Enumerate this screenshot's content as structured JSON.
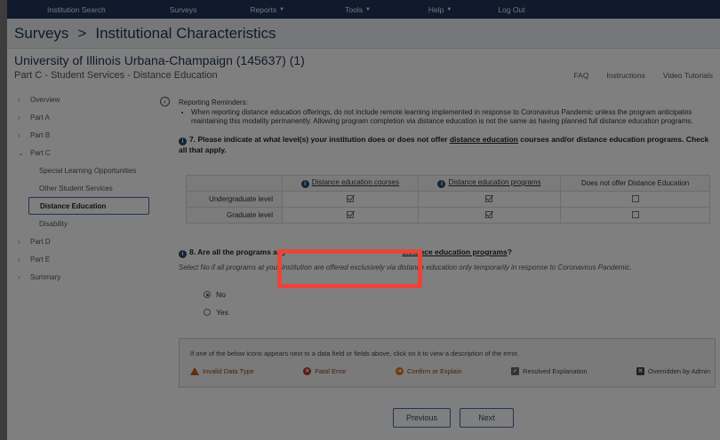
{
  "nav": {
    "items": [
      {
        "label": "Institution Search",
        "caret": false
      },
      {
        "label": "Surveys",
        "caret": false
      },
      {
        "label": "Reports",
        "caret": true
      },
      {
        "label": "Tools",
        "caret": true
      },
      {
        "label": "Help",
        "caret": true
      },
      {
        "label": "Log Out",
        "caret": false
      }
    ]
  },
  "breadcrumb": {
    "root": "Surveys",
    "separator": ">",
    "current": "Institutional Characteristics"
  },
  "institution": "University of Illinois Urbana-Champaign (145637) (1)",
  "part_title": "Part C - Student Services - Distance Education",
  "toplinks": [
    "FAQ",
    "Instructions",
    "Video Tutorials"
  ],
  "sidebar": {
    "items": [
      "Overview",
      "Part A",
      "Part B",
      "Part C"
    ],
    "sub_items": [
      "Special Learning Opportunities",
      "Other Student Services",
      "Distance Education",
      "Disability"
    ],
    "more_items": [
      "Part D",
      "Part E",
      "Summary"
    ]
  },
  "reminders": {
    "title": "Reporting Reminders:",
    "bullet": "When reporting distance education offerings, do not include remote learning implemented in response to Coronavirus Pandemic unless the program anticipates maintaining this modality permanently. Allowing program completion via distance education is not the same as having planned full distance education programs."
  },
  "q7": {
    "prefix": "7. Please indicate at what level(s) your institution does or does not offer",
    "link": "distance education",
    "suffix": "courses and/or distance education programs. Check all that apply.",
    "columns": [
      "Distance education courses",
      "Distance education programs",
      "Does not offer Distance Education"
    ],
    "rows": [
      {
        "label": "Undergraduate level",
        "values": [
          true,
          true,
          false
        ]
      },
      {
        "label": "Graduate level",
        "values": [
          true,
          true,
          false
        ]
      }
    ]
  },
  "q8": {
    "prefix": "8. Are all the programs at y",
    "link": "distance education programs",
    "suffix": "?",
    "help": "Select No if all programs at your institution are offered exclusively via distance education only temporarily in response to Coronavirus Pandemic.",
    "options": [
      {
        "label": "No",
        "selected": true
      },
      {
        "label": "Yes",
        "selected": false
      }
    ]
  },
  "legend": {
    "note": "If one of the below icons appears next to a data field or fields above, click on it to view a description of the error.",
    "items": [
      "Invalid Data Type",
      "Fatal Error",
      "Confirm or Explain",
      "Resolved Explanation",
      "Overridden by Admin"
    ]
  },
  "buttons": {
    "previous": "Previous",
    "next": "Next"
  },
  "colors": {
    "navbar": "#1f3559",
    "highlight": "#e8453a",
    "accent": "#3a6aa8"
  }
}
